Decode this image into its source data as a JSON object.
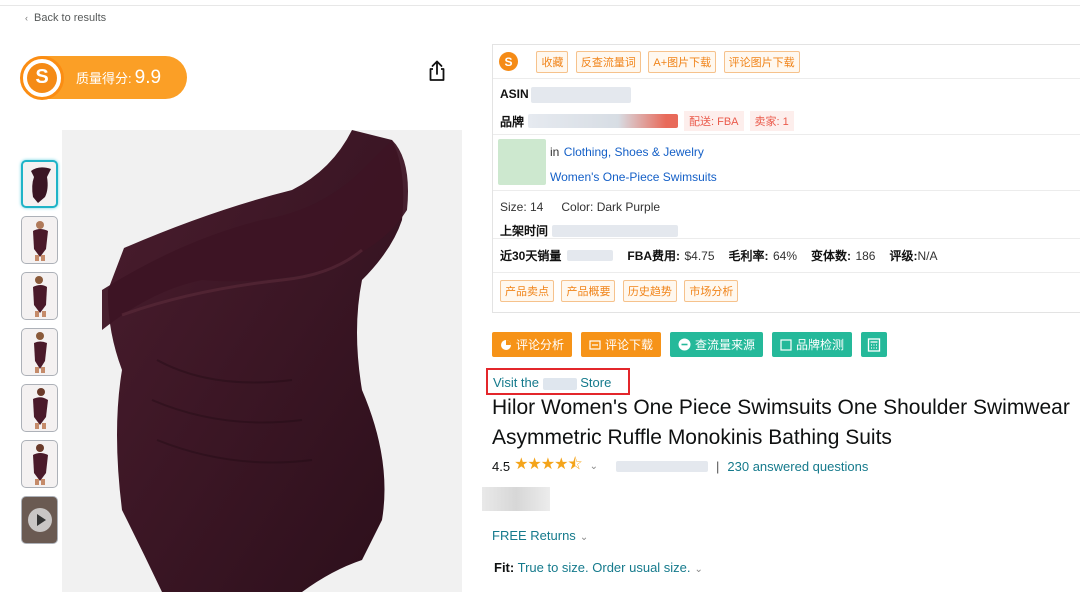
{
  "nav": {
    "back_label": "Back to results"
  },
  "score": {
    "label": "质量得分:",
    "value": "9.9",
    "logo_letter": "S"
  },
  "share": {
    "icon": "share-icon"
  },
  "panel": {
    "logo_letter": "S",
    "tools": [
      "收藏",
      "反查流量词",
      "A+图片下载",
      "评论图片下载"
    ],
    "asin_label": "ASIN",
    "brand_label": "品牌",
    "delivery": "配送: FBA",
    "sellers": "卖家: 1",
    "category_prefix": "in",
    "category_1": "Clothing, Shoes & Jewelry",
    "category_2": "Women's One-Piece Swimsuits",
    "size": "Size: 14",
    "color": "Color: Dark Purple",
    "listed_label": "上架时间",
    "sales_label": "近30天销量",
    "fba_fee_label": "FBA费用:",
    "fba_fee_value": "$4.75",
    "margin_label": "毛利率:",
    "margin_value": "64%",
    "variants_label": "变体数:",
    "variants_value": "186",
    "grade_label": "评级:",
    "grade_value": "N/A",
    "tabs": [
      "产品卖点",
      "产品概要",
      "历史趋势",
      "市场分析"
    ]
  },
  "actions": [
    {
      "label": "评论分析",
      "color": "orange",
      "icon": "pie-chart-icon"
    },
    {
      "label": "评论下载",
      "color": "orange",
      "icon": "download-icon"
    },
    {
      "label": "查流量来源",
      "color": "green",
      "icon": "traffic-icon"
    },
    {
      "label": "品牌检测",
      "color": "green",
      "icon": "checkbox-icon"
    },
    {
      "label": "",
      "color": "green",
      "icon": "calculator-icon"
    }
  ],
  "store": {
    "prefix": "Visit the",
    "suffix": "Store"
  },
  "product": {
    "title_line1": "Hilor Women's One Piece Swimsuits One Shoulder Swimwear",
    "title_line2": "Asymmetric Ruffle Monokinis Bathing Suits",
    "rating": "4.5",
    "stars": "★★★★⯪",
    "separator": "|",
    "answered": "230 answered questions",
    "returns": "FREE Returns",
    "fit_label": "Fit:",
    "fit_value": "True to size. Order usual size."
  },
  "colors": {
    "accent": "#f69318",
    "green": "#25b99a",
    "link": "#157a8c",
    "highlight": "#e3262b",
    "swimsuit": "#3a1624"
  }
}
